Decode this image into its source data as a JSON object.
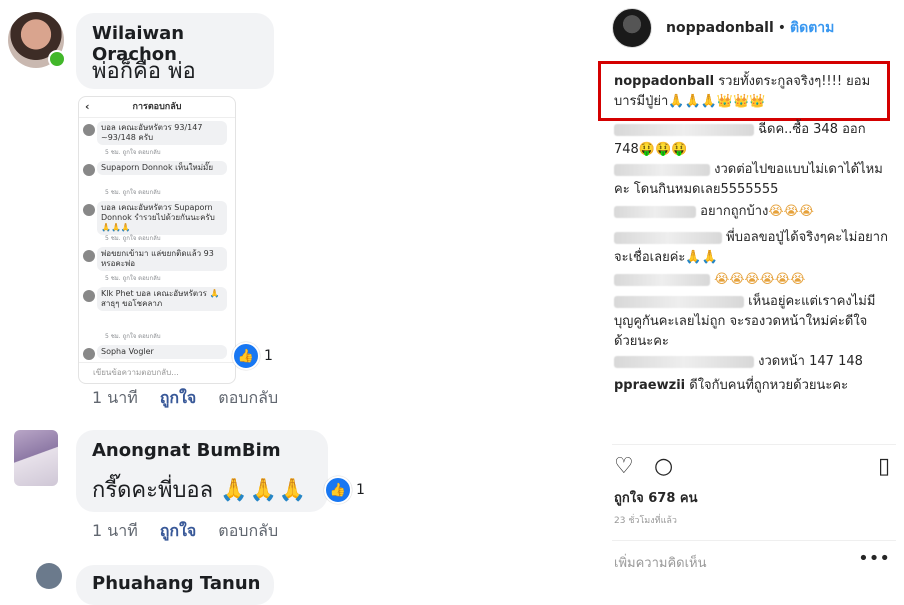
{
  "fb": {
    "comments": [
      {
        "name": "Wilaiwan Orachon",
        "text": "พ่อก็คือ พ่อ",
        "time": "1 นาที",
        "like": "ถูกใจ",
        "reply": "ตอบกลับ",
        "reactions": "1"
      },
      {
        "name": "Anongnat BumBim",
        "text": "กรี๊ดคะพี่บอล",
        "emoji": "🙏🙏🙏",
        "time": "1 นาที",
        "like": "ถูกใจ",
        "reply": "ตอบกลับ",
        "reactions": "1"
      },
      {
        "name": "Phuahang Tanun"
      }
    ],
    "screenshot": {
      "header": "การตอบกลับ",
      "back": "‹",
      "items": [
        {
          "text": "บอล เคณะอัษหรัตวร 93/147 ~93/148 ครับ",
          "meta": "5 ชม.  ถูกใจ  ตอบกลับ"
        },
        {
          "text": "Supaporn Donnok เห็นใหม่มั๊ย",
          "meta": "5 ชม.  ถูกใจ  ตอบกลับ"
        },
        {
          "text": "บอล เคณะอัษหรัตวร Supaporn Donnok รำรวยไปด้วยกันนะครับ 🙏🙏🙏",
          "meta": "5 ชม.  ถูกใจ  ตอบกลับ"
        },
        {
          "text": "พ่อขยกเข้ามา แล่ขยกติดแล้ว 93 หรอคะพ่อ",
          "meta": "5 ชม.  ถูกใจ  ตอบกลับ"
        },
        {
          "text": "Klk Phet บอล เคณะอัษหรัตวร 🙏 สาธุๆ ขอโชคลาภ",
          "meta": "5 ชม.  ถูกใจ  ตอบกลับ"
        },
        {
          "text": "Sopha Vogler",
          "meta": ""
        }
      ],
      "compose": "เขียนข้อความตอบกลับ..."
    }
  },
  "ig": {
    "username": "noppadonball",
    "follow": "ติดตาม",
    "caption_user": "noppadonball",
    "caption_text": "รวยทั้งตระกูลจริงๆ!!!! ยอมบารมีปู่ย่า",
    "caption_emoji": "🙏🙏🙏👑👑👑",
    "comments": [
      {
        "text": "ฉีดค..ซื้อ 348 ออก 748",
        "emoji": "🤑🤑🤑"
      },
      {
        "text": "งวดต่อไปขอแบบไม่เดาได้ไหมคะ โดนกินหมดเลย5555555",
        "emoji": ""
      },
      {
        "text": "อยากถูกบ้าง",
        "emoji": "😭😭😭"
      },
      {
        "text": "พี่บอลขอปู่ได้จริงๆคะไม่อยากจะเชื่อเลยค่ะ",
        "emoji": "🙏🙏"
      },
      {
        "text": "",
        "emoji": "😭😭😭😭😭😭"
      },
      {
        "text": "เห็นอยู่คะแต่เราคงไม่มีบุญคูกันคะเลยไม่ถูก จะรองวดหน้าใหม่ค่ะดีใจด้วยนะคะ",
        "emoji": ""
      },
      {
        "text": "งวดหน้า 147 148",
        "emoji": ""
      },
      {
        "user": "ppraewzii",
        "text": "ดีใจกับคนที่ถูกหวยด้วยนะคะ",
        "emoji": ""
      }
    ],
    "likes": "ถูกใจ 678 คน",
    "time": "23 ชั่วโมงที่แล้ว",
    "add_comment": "เพิ่มความคิดเห็น",
    "more": "•••"
  }
}
